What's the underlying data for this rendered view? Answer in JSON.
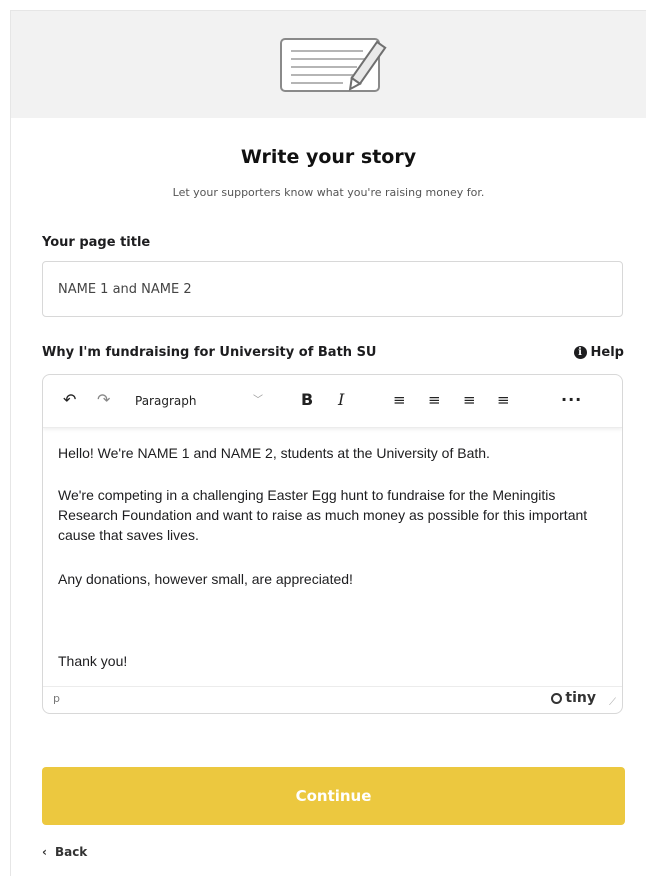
{
  "header": {
    "icon": "notepad-pencil-icon",
    "title": "Write your story",
    "subtitle": "Let your supporters know what you're raising money for."
  },
  "page_title_field": {
    "label": "Your page title",
    "value": "NAME 1 and NAME 2"
  },
  "story_field": {
    "label": "Why I'm fundraising for University of Bath SU",
    "help_label": "Help"
  },
  "toolbar": {
    "undo_icon": "↶",
    "redo_icon": "↷",
    "block_format": "Paragraph",
    "bold": "B",
    "italic": "I",
    "align_left": "≡",
    "align_center": "≡",
    "align_right": "≡",
    "align_justify": "≡",
    "more": "···"
  },
  "editor": {
    "paragraphs": [
      "Hello! We're NAME 1 and NAME 2, students at the University of Bath.",
      "We're competing in a challenging Easter Egg hunt to fundraise for the Meningitis Research Foundation and want to raise as much money as possible for this important cause that saves lives.",
      "Any donations, however small, are appreciated!",
      "Thank you!"
    ],
    "status_path": "p",
    "brand": "tiny"
  },
  "actions": {
    "continue_label": "Continue",
    "back_label": "Back"
  },
  "colors": {
    "accent": "#ecc83f",
    "hero_bg": "#f2f2f2"
  }
}
